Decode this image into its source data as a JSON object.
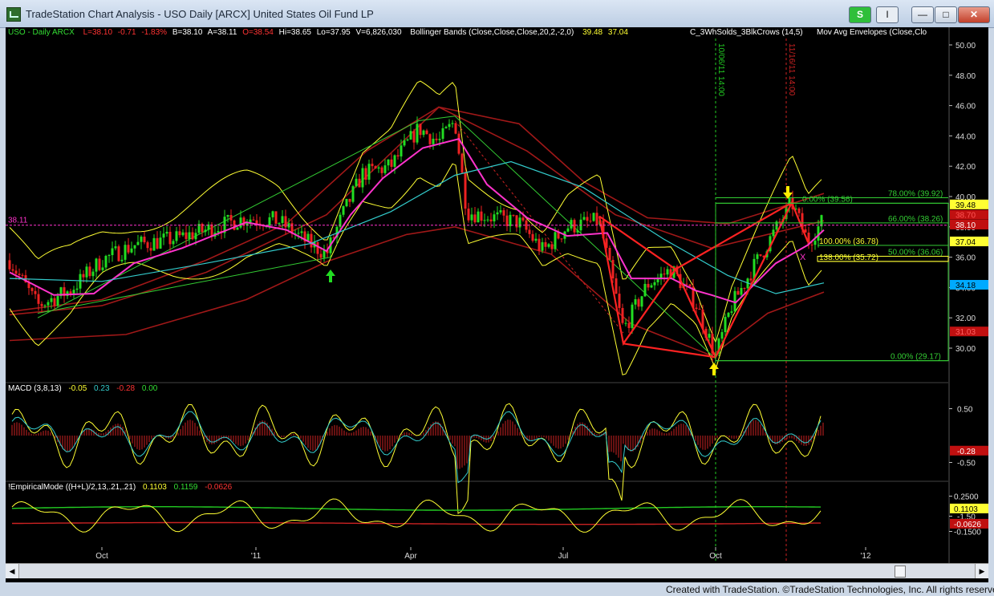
{
  "window": {
    "title": "TradeStation Chart Analysis - USO Daily [ARCX] United States Oil Fund LP",
    "btn_s": "S",
    "btn_i": "I",
    "minimize": "—",
    "maximize": "□",
    "close": "✕"
  },
  "legend": {
    "symbol": "USO - Daily  ARCX",
    "last": "L=38.10",
    "change": "-0.71",
    "pct": "-1.83%",
    "bid": "B=38.10",
    "ask": "A=38.11",
    "open": "O=38.54",
    "hi": "Hi=38.65",
    "lo": "Lo=37.95",
    "vol": "V=6,826,030",
    "bb_label": "Bollinger Bands (Close,Close,Close,20,2,-2,0)",
    "bb_up": "39.48",
    "bb_low": "37.04",
    "pattern": "C_3WhSolds_3BlkCrows (14,5)",
    "envelope": "Mov Avg Envelopes (Close,Clo"
  },
  "price_axis": [
    "50.00",
    "48.00",
    "46.00",
    "44.00",
    "42.00",
    "40.00",
    "38.00",
    "36.00",
    "34.00",
    "32.00",
    "30.00"
  ],
  "price_tags": [
    {
      "text": "39.48",
      "value": 39.48,
      "bg": "#ffff33",
      "fg": "#000000"
    },
    {
      "text": "38.70",
      "value": 38.8,
      "bg": "#c01010",
      "fg": "#ff5555"
    },
    {
      "text": "38.10",
      "value": 38.15,
      "bg": "#c01010",
      "fg": "#ffffff"
    },
    {
      "text": "37.04",
      "value": 37.04,
      "bg": "#ffff33",
      "fg": "#000000"
    },
    {
      "text": "34.18",
      "value": 34.18,
      "bg": "#00aaff",
      "fg": "#000000"
    },
    {
      "text": "31.03",
      "value": 31.1,
      "bg": "#c01010",
      "fg": "#ff6060"
    }
  ],
  "left_price": "38.11",
  "fib": [
    {
      "text": "78.00% (39.92)",
      "value": 39.92
    },
    {
      "text": "0.00% (39.56)",
      "value": 39.56
    },
    {
      "text": "66.00% (38.26)",
      "value": 38.26
    },
    {
      "text": "100.00% (36.78)",
      "value": 36.78
    },
    {
      "text": "50.00% (36.06)",
      "value": 36.06
    },
    {
      "text": "138.00% (35.72)",
      "value": 35.72
    },
    {
      "text": "0.00% (29.17)",
      "value": 29.17
    }
  ],
  "vlines": [
    {
      "text": "10/06/11 14:00",
      "color": "#22cc22"
    },
    {
      "text": "11/16/11 14:00",
      "color": "#cc2222"
    }
  ],
  "macd": {
    "title": "MACD (3,8,13)",
    "v1": "-0.05",
    "v2": "0.23",
    "v3": "-0.28",
    "v4": "0.00",
    "axis": [
      "0.50",
      "-0.50",
      "-1.50"
    ],
    "tag": "-0.28"
  },
  "emd": {
    "title": "!EmpiricalMode ((H+L)/2,13,.21,.21)",
    "v1": "0.1103",
    "v2": "0.1159",
    "v3": "-0.0626",
    "axis": [
      "0.2500",
      "-0.1500"
    ],
    "tag1": "0.1103",
    "tag2": "-0.0626"
  },
  "date_axis": [
    "Oct",
    "'11",
    "Apr",
    "Jul",
    "Oct",
    "'12"
  ],
  "credit": "Created with TradeStation. ©TradeStation Technologies, Inc. All rights reserved.",
  "colors": {
    "background": "#000000",
    "bollinger": "#ffff33",
    "envelope": "#a01818",
    "ma_short": "#ff33cc",
    "ma_long": "#33cccc",
    "trend": "#33cc33",
    "pattern": "#ff2222",
    "up_bar": "#22dd22",
    "down_bar": "#ee2222"
  }
}
